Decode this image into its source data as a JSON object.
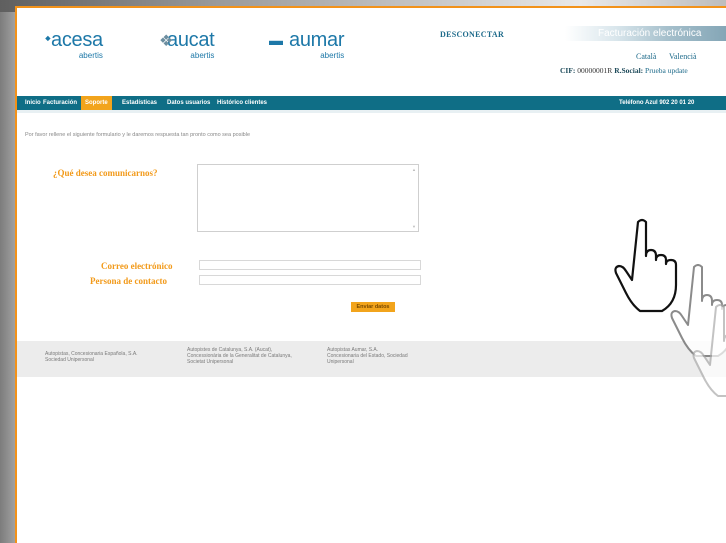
{
  "header": {
    "logos": [
      {
        "name": "acesa",
        "sub": "abertis"
      },
      {
        "name": "aucat",
        "sub": "abertis"
      },
      {
        "name": "aumar",
        "sub": "abertis"
      }
    ],
    "disconnect_label": "DESCONECTAR",
    "portal_title": "Facturación electrónica",
    "languages": [
      "Català",
      "Valencià"
    ],
    "cif_label": "CIF:",
    "cif_value": "00000001R",
    "razon_label": "R.Social:",
    "razon_value": "Prueba update"
  },
  "nav": {
    "items": [
      "Inicio",
      "Facturación",
      "Soporte",
      "Estadísticas",
      "Datos usuarios",
      "Histórico clientes"
    ],
    "active_index": 2,
    "phone": "Teléfono Azul 902 20 01 20"
  },
  "form": {
    "instructions": "Por favor rellene el siguiente formulario y le daremos respuesta tan pronto como sea posible",
    "message_label": "¿Qué desea comunicarnos?",
    "message_value": "",
    "email_label": "Correo electrónico",
    "email_value": "",
    "contact_label": "Persona de contacto",
    "contact_value": "",
    "submit_label": "Enviar datos"
  },
  "footer": {
    "columns": [
      [
        "Autopistas, Concesionaria Española, S.A.",
        "Sociedad Unipersonal"
      ],
      [
        "Autopistes de Catalunya, S.A. (Aucat),",
        "Concessionària de la Generalitat de Catalunya,",
        "Societat Unipersonal"
      ],
      [
        "Autopistas Aumar, S.A.",
        "Concesionaria del Estado, Sociedad",
        "Unipersonal"
      ]
    ]
  },
  "colors": {
    "accent": "#f2a41c",
    "nav": "#0f6e86",
    "brand": "#1d78a8",
    "page_border": "#f2921a"
  },
  "icons": [
    "hand-pointer-icon",
    "hand-pointer-icon",
    "hand-pointer-icon"
  ]
}
